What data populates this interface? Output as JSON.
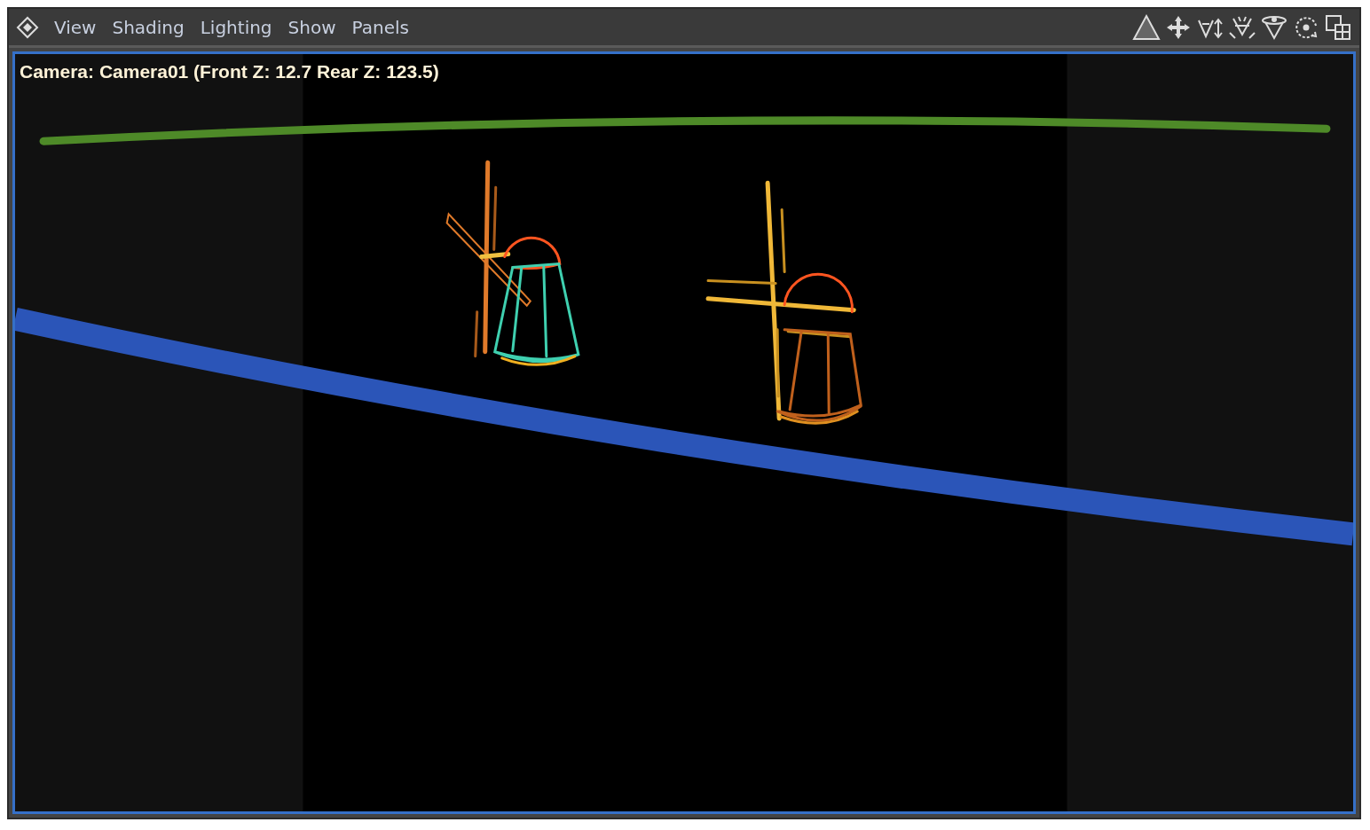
{
  "menu_bar": {
    "menus": [
      {
        "label": "View"
      },
      {
        "label": "Shading"
      },
      {
        "label": "Lighting"
      },
      {
        "label": "Show"
      },
      {
        "label": "Panels"
      }
    ]
  },
  "viewport": {
    "camera_label": "Camera: Camera01 (Front Z: 12.7 Rear Z: 123.5)"
  }
}
